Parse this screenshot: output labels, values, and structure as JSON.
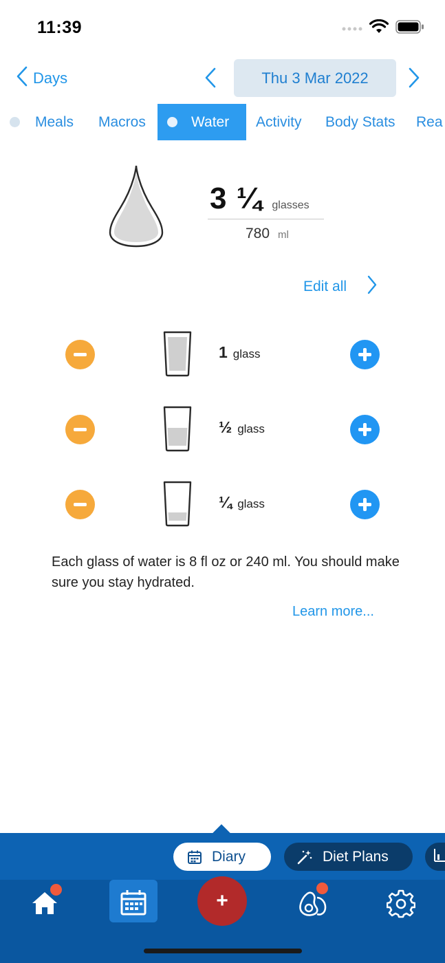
{
  "status_bar": {
    "time": "11:39"
  },
  "date_nav": {
    "back_label": "Days",
    "current_date": "Thu 3 Mar 2022"
  },
  "tabs": [
    {
      "label": "Meals",
      "dot": true,
      "active": false
    },
    {
      "label": "Macros",
      "dot": false,
      "active": false
    },
    {
      "label": "Water",
      "dot": true,
      "active": true
    },
    {
      "label": "Activity",
      "dot": false,
      "active": false
    },
    {
      "label": "Body Stats",
      "dot": false,
      "active": false
    },
    {
      "label": "Rea",
      "dot": false,
      "active": false
    }
  ],
  "summary": {
    "glasses": "3 ¼",
    "glasses_unit": "glasses",
    "ml": "780",
    "ml_unit": "ml"
  },
  "edit_all": {
    "label": "Edit all"
  },
  "glass_rows": [
    {
      "amount": "1",
      "unit": "glass",
      "fill": 1.0
    },
    {
      "amount": "½",
      "unit": "glass",
      "fill": 0.5
    },
    {
      "amount": "¼",
      "unit": "glass",
      "fill": 0.25
    }
  ],
  "info": {
    "text": "Each glass of water is 8 fl oz or 240 ml. You should make sure you stay hydrated.",
    "learn_more": "Learn more..."
  },
  "quick_pills": {
    "diary": "Diary",
    "diet_plans": "Diet Plans"
  },
  "bottom_nav": {
    "add_symbol": "+"
  },
  "colors": {
    "accent": "#2196e8",
    "active_tab": "#2d9cf0",
    "minus": "#f6a93b",
    "plus": "#2196f3",
    "nav_bg": "#0a57a0",
    "add_button": "#b22a2a",
    "badge": "#f05a3c"
  }
}
